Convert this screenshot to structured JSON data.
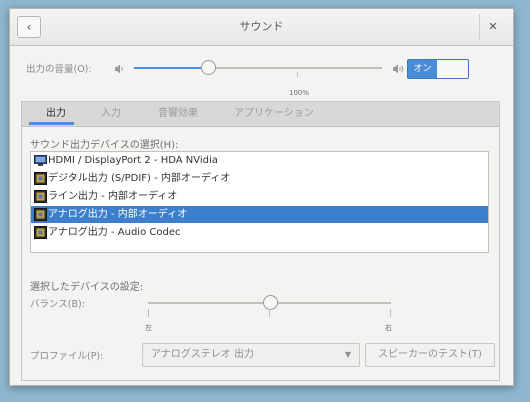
{
  "window": {
    "title": "サウンド"
  },
  "output_volume": {
    "label": "出力の音量(O):",
    "level_percent": 30,
    "mark_label": "100%",
    "mute_toggle": {
      "on_label": "オン",
      "state": "on"
    },
    "icons": [
      "speaker-low-icon",
      "speaker-high-icon"
    ]
  },
  "tabs": [
    {
      "label": "出力",
      "active": true
    },
    {
      "label": "入力",
      "active": false
    },
    {
      "label": "音響効果",
      "active": false
    },
    {
      "label": "アプリケーション",
      "active": false
    }
  ],
  "device_section": {
    "title": "サウンド出力デバイスの選択(H):",
    "devices": [
      {
        "label": "HDMI / DisplayPort 2 - HDA NVidia",
        "icon": "monitor-icon",
        "selected": false
      },
      {
        "label": "デジタル出力 (S/PDIF) - 内部オーディオ",
        "icon": "sound-card-icon",
        "selected": false
      },
      {
        "label": "ライン出力 - 内部オーディオ",
        "icon": "sound-card-icon",
        "selected": false
      },
      {
        "label": "アナログ出力 - 内部オーディオ",
        "icon": "sound-card-icon",
        "selected": true
      },
      {
        "label": "アナログ出力 - Audio Codec",
        "icon": "sound-card-icon",
        "selected": false
      }
    ]
  },
  "settings": {
    "title": "選択したデバイスの設定:",
    "balance_label": "バランス(B):",
    "balance_value": 0,
    "left_label": "左",
    "right_label": "右",
    "profile_label": "プロファイル(P):",
    "profile_value": "アナログステレオ 出力",
    "test_button": "スピーカーのテスト(T)"
  },
  "colors": {
    "accent": "#4a90d9",
    "selection": "#3d7fcc"
  }
}
